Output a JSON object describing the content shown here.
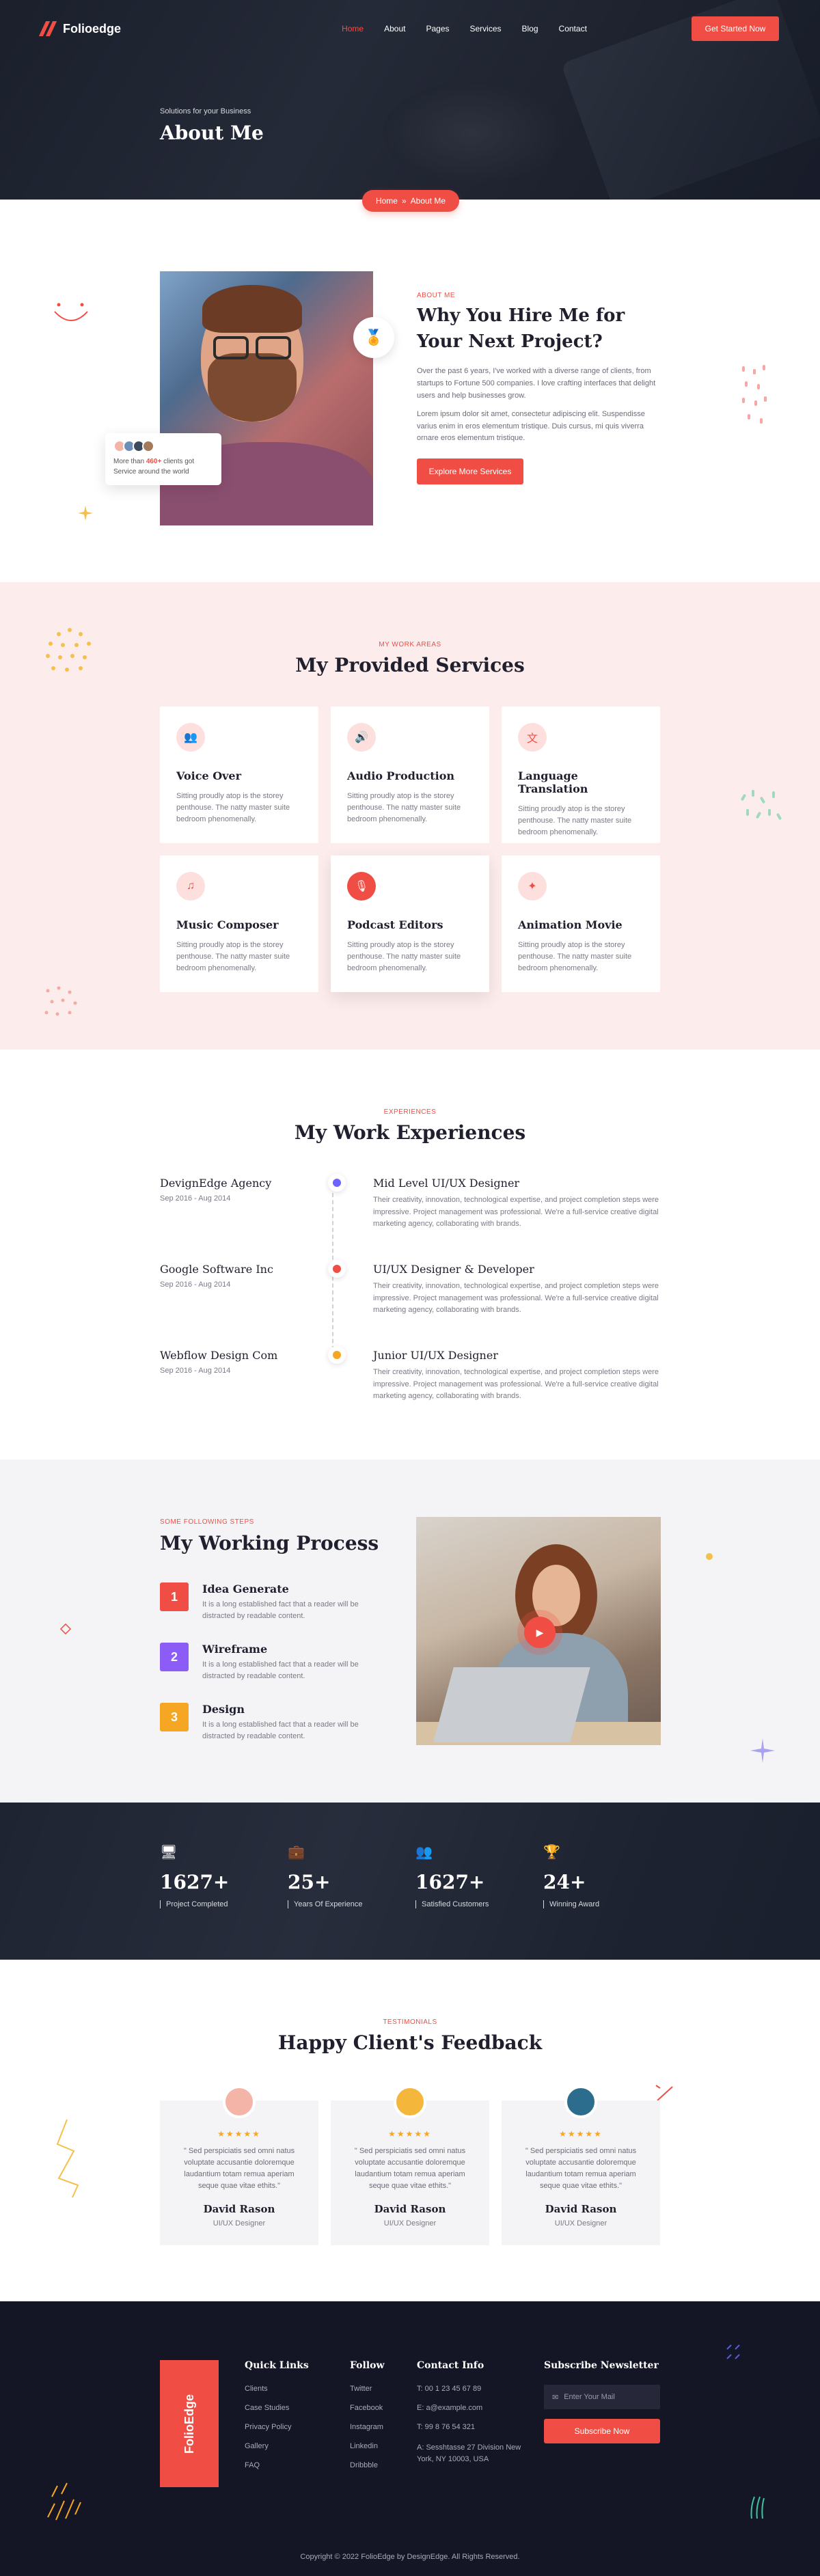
{
  "nav": {
    "brand": "Folioedge",
    "items": [
      "Home",
      "About",
      "Pages",
      "Services",
      "Blog",
      "Contact"
    ],
    "active_index": 0,
    "cta": "Get Started Now"
  },
  "hero": {
    "subtitle": "Solutions for your Business",
    "title": "About Me",
    "breadcrumb_home": "Home",
    "breadcrumb_sep": "»",
    "breadcrumb_current": "About Me"
  },
  "about": {
    "label": "ABOUT ME",
    "title": "Why You Hire Me for Your Next Project?",
    "p1": "Over the past 6 years, I've worked with a diverse range of clients, from startups to Fortune 500 companies. I love crafting interfaces that delight users and help businesses grow.",
    "p2": "Lorem ipsum dolor sit amet, consectetur adipiscing elit. Suspendisse varius enim in eros elementum tristique. Duis cursus, mi quis viverra ornare eros elementum tristique.",
    "button": "Explore More Services",
    "clients_prefix": "More than ",
    "clients_count": "460+",
    "clients_suffix": " clients got Service around the world"
  },
  "services": {
    "label": "MY WORK AREAS",
    "title": "My Provided Services",
    "items": [
      {
        "title": "Voice Over",
        "desc": "Sitting proudly atop is the storey penthouse. The natty master suite bedroom phenomenally.",
        "icon": "users-icon",
        "glyph": "👥"
      },
      {
        "title": "Audio Production",
        "desc": "Sitting proudly atop is the storey penthouse. The natty master suite bedroom phenomenally.",
        "icon": "speaker-icon",
        "glyph": "🔊"
      },
      {
        "title": "Language Translation",
        "desc": "Sitting proudly atop is the storey penthouse. The natty master suite bedroom phenomenally.",
        "icon": "translate-icon",
        "glyph": "文"
      },
      {
        "title": "Music Composer",
        "desc": "Sitting proudly atop is the storey penthouse. The natty master suite bedroom phenomenally.",
        "icon": "music-icon",
        "glyph": "♫"
      },
      {
        "title": "Podcast Editors",
        "desc": "Sitting proudly atop is the storey penthouse. The natty master suite bedroom phenomenally.",
        "icon": "microphone-icon",
        "glyph": "🎙"
      },
      {
        "title": "Animation Movie",
        "desc": "Sitting proudly atop is the storey penthouse. The natty master suite bedroom phenomenally.",
        "icon": "animation-icon",
        "glyph": "✦"
      }
    ]
  },
  "experience": {
    "label": "EXPERIENCES",
    "title": "My Work Experiences",
    "items": [
      {
        "company": "DevignEdge Agency",
        "date": "Sep 2016 - Aug 2014",
        "role": "Mid Level UI/UX Designer",
        "desc": "Their creativity, innovation, technological expertise, and project completion steps were impressive. Project management was professional. We're a full-service creative digital marketing agency, collaborating with brands.",
        "color": "#6c63ff"
      },
      {
        "company": "Google Software Inc",
        "date": "Sep 2016 - Aug 2014",
        "role": "UI/UX Designer & Developer",
        "desc": "Their creativity, innovation, technological expertise, and project completion steps were impressive. Project management was professional. We're a full-service creative digital marketing agency, collaborating with brands.",
        "color": "#f04e45"
      },
      {
        "company": "Webflow Design Com",
        "date": "Sep 2016 - Aug 2014",
        "role": "Junior UI/UX Designer",
        "desc": "Their creativity, innovation, technological expertise, and project completion steps were impressive. Project management was professional. We're a full-service creative digital marketing agency, collaborating with brands.",
        "color": "#f5a623"
      }
    ]
  },
  "process": {
    "label": "SOME FOLLOWING STEPS",
    "title": "My Working Process",
    "steps": [
      {
        "num": "1",
        "title": "Idea Generate",
        "desc": "It is a long established fact that a reader will be distracted by readable content.",
        "color": "#f04e45"
      },
      {
        "num": "2",
        "title": "Wireframe",
        "desc": "It is a long established fact that a reader will be distracted by readable content.",
        "color": "#8b5cf6"
      },
      {
        "num": "3",
        "title": "Design",
        "desc": "It is a long established fact that a reader will be distracted by readable content.",
        "color": "#f5a623"
      }
    ]
  },
  "stats": [
    {
      "value": "1627+",
      "caption": "Project Completed",
      "icon": "monitor-icon",
      "glyph": "🖥",
      "color": "#8b5cf6"
    },
    {
      "value": "25+",
      "caption": "Years Of Experience",
      "icon": "briefcase-icon",
      "glyph": "💼",
      "color": "#f5a623"
    },
    {
      "value": "1627+",
      "caption": "Satisfied Customers",
      "icon": "customers-icon",
      "glyph": "👥",
      "color": "#3cc4a0"
    },
    {
      "value": "24+",
      "caption": "Winning Award",
      "icon": "trophy-icon",
      "glyph": "🏆",
      "color": "#f04e45"
    }
  ],
  "testimonials": {
    "label": "TESTIMONIALS",
    "title": "Happy Client's Feedback",
    "items": [
      {
        "quote": "\" Sed perspiciatis sed omni natus voluptate accusantie doloremque laudantium totam remua aperiam seque quae vitae ethits.\"",
        "name": "David Rason",
        "role": "UI/UX Designer",
        "stars": "★★★★★",
        "avatar_color": "#f4b4a8"
      },
      {
        "quote": "\" Sed perspiciatis sed omni natus voluptate accusantie doloremque laudantium totam remua aperiam seque quae vitae ethits.\"",
        "name": "David Rason",
        "role": "UI/UX Designer",
        "stars": "★★★★★",
        "avatar_color": "#f5b73b"
      },
      {
        "quote": "\" Sed perspiciatis sed omni natus voluptate accusantie doloremque laudantium totam remua aperiam seque quae vitae ethits.\"",
        "name": "David Rason",
        "role": "UI/UX Designer",
        "stars": "★★★★★",
        "avatar_color": "#2c6c8c"
      }
    ]
  },
  "footer": {
    "brand": "FolioEdge",
    "quick_links_title": "Quick Links",
    "quick_links": [
      "Clients",
      "Case Studies",
      "Privacy Policy",
      "Gallery",
      "FAQ"
    ],
    "follow_title": "Follow",
    "follow": [
      "Twitter",
      "Facebook",
      "Instagram",
      "Linkedin",
      "Dribbble"
    ],
    "contact_title": "Contact Info",
    "contact": [
      "T: 00 1 23 45 67 89",
      "E: a@example.com",
      "T: 99 8 76 54 321",
      "A: Sesshtasse 27 Division New York, NY 10003, USA"
    ],
    "newsletter_title": "Subscribe Newsletter",
    "newsletter_placeholder": "Enter Your Mail",
    "newsletter_button": "Subscribe Now",
    "copyright": "Copyright © 2022 FolioEdge by DesignEdge. All Rights Reserved."
  }
}
